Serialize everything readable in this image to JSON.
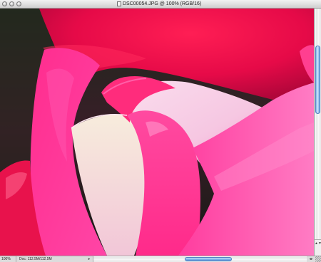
{
  "window": {
    "title": "DSC00054.JPG @ 100% (RGB/16)"
  },
  "status": {
    "zoom": "100%",
    "doc_size": "Doc: 112.5M/112.5M",
    "menu_arrow": "▸"
  },
  "scroll": {
    "v_arrows": "▲▼",
    "h_arrows": "◂▸"
  },
  "colors": {
    "rose_red": "#e0104f",
    "rose_pink": "#ff2c8d",
    "petal_light": "#f7bde0",
    "petal_cream": "#f4e6d8",
    "scroll_blue": "#7fb3ea"
  },
  "icons": {
    "document": "document-icon",
    "close": "close-icon",
    "minimize": "minimize-icon",
    "zoom": "zoom-icon"
  }
}
